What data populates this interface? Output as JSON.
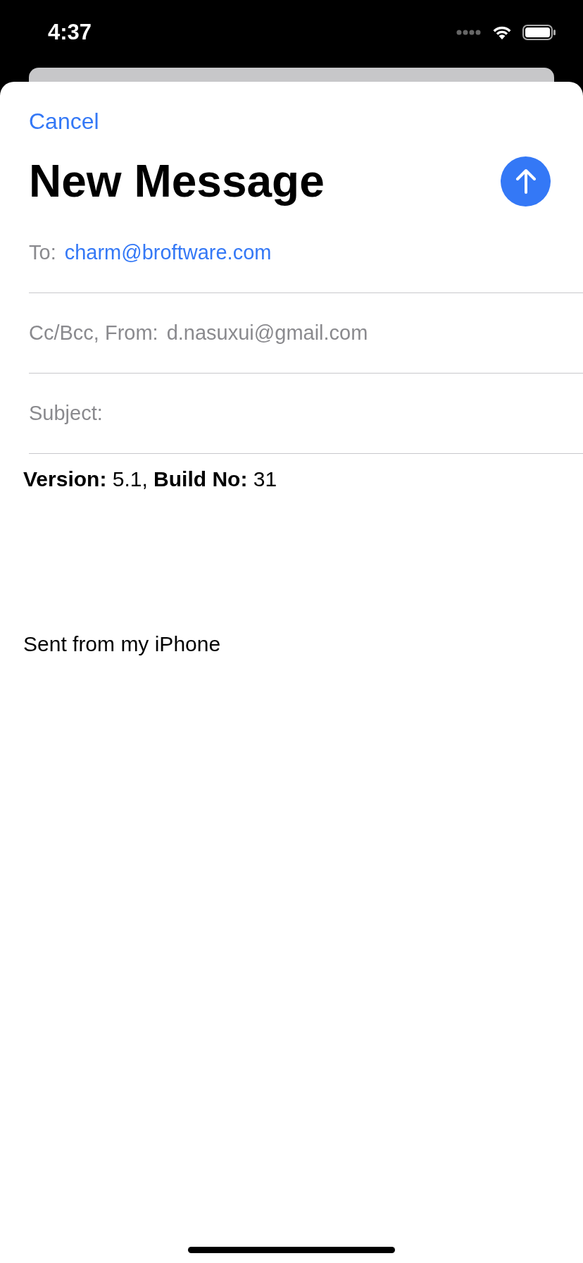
{
  "status_bar": {
    "time": "4:37"
  },
  "header": {
    "cancel": "Cancel",
    "title": "New Message"
  },
  "fields": [
    {
      "label": "To:",
      "value": "charm@broftware.com",
      "kind": "recipient"
    },
    {
      "label": "Cc/Bcc, From:",
      "value": "d.nasuxui@gmail.com",
      "kind": "sender"
    },
    {
      "label": "Subject:",
      "kind": "subject"
    }
  ],
  "body": {
    "text": "**Version:** 5.1, **Build No:** 31",
    "signature": "Sent from my iPhone"
  }
}
